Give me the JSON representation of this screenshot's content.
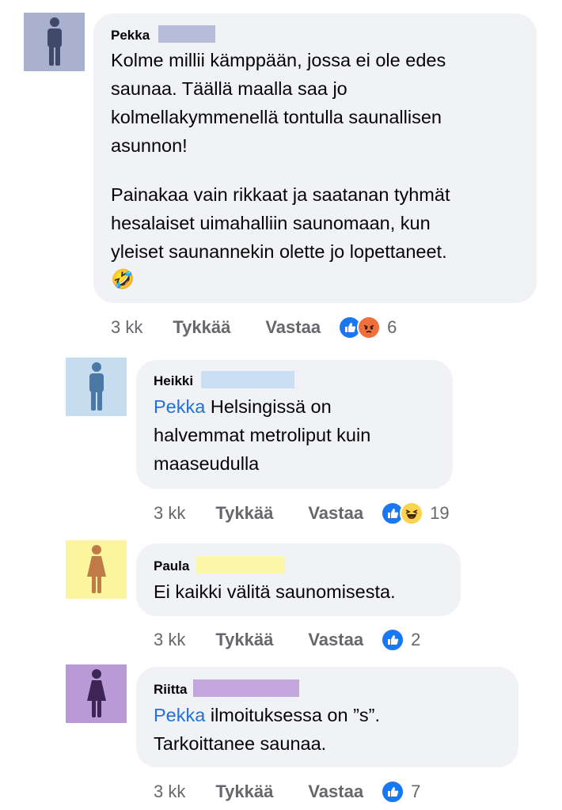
{
  "comments": [
    {
      "author": "Pekka",
      "paragraphs": [
        [
          "Kolme millii kämppään, jossa ei ole edes",
          "saunaa. Täällä maalla saa jo",
          "kolmellakymmenellä tontulla saunallisen",
          "asunnon!"
        ],
        [
          "Painakaa vain rikkaat ja saatanan tyhmät",
          "hesalaiset uimahalliin saunomaan, kun",
          "yleiset saunannekin olette jo lopettaneet."
        ]
      ],
      "emoji": "🤣",
      "time": "3 kk",
      "like_label": "Tykkää",
      "reply_label": "Vastaa",
      "reactions": [
        "like-icon",
        "angry-icon"
      ],
      "reaction_count": "6",
      "avatar_color": "#a9b1cf",
      "figure_color": "#3f4a6a",
      "redact_color": "#b7bcd8"
    },
    {
      "author": "Heikki",
      "mention": "Pekka",
      "lines": [
        " Helsingissä on",
        "halvemmat metroliput kuin",
        "maaseudulla"
      ],
      "time": "3 kk",
      "like_label": "Tykkää",
      "reply_label": "Vastaa",
      "reactions": [
        "like-icon",
        "haha-icon"
      ],
      "reaction_count": "19",
      "avatar_color": "#c6dcef",
      "figure_color": "#4a79a8",
      "redact_color": "#c9e0f4"
    },
    {
      "author": "Paula",
      "lines": [
        "Ei kaikki välitä saunomisesta."
      ],
      "time": "3 kk",
      "like_label": "Tykkää",
      "reply_label": "Vastaa",
      "reactions": [
        "like-icon"
      ],
      "reaction_count": "2",
      "avatar_color": "#fbf59d",
      "figure_color": "#c07a48",
      "redact_color": "#fbf7a6"
    },
    {
      "author": "Riitta",
      "mention": "Pekka",
      "lines": [
        " ilmoituksessa on ”s”.",
        "Tarkoittanee saunaa."
      ],
      "time": "3 kk",
      "like_label": "Tykkää",
      "reply_label": "Vastaa",
      "reactions": [
        "like-icon"
      ],
      "reaction_count": "7",
      "avatar_color": "#b99ad6",
      "figure_color": "#3d2656",
      "redact_color": "#c2a6dc"
    }
  ],
  "colors": {
    "like_blue": "#1877f2",
    "angry_orange": "#f0703c",
    "haha_yellow": "#fcd34d",
    "mention_blue": "#216fdb",
    "bubble_bg": "#f0f2f5"
  }
}
